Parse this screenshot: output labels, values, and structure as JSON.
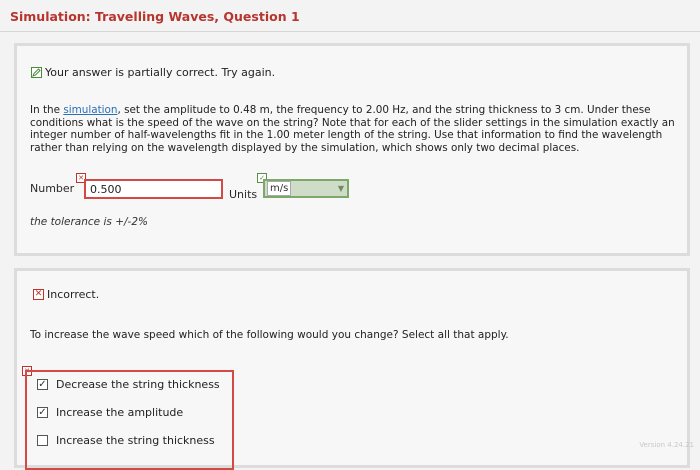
{
  "header": {
    "title": "Simulation: Travelling Waves, Question 1"
  },
  "part1": {
    "status": "Your answer is partially correct.  Try again.",
    "question_pre": "In the ",
    "question_link": "simulation",
    "question_post": ", set the amplitude to 0.48 m, the frequency to 2.00 Hz, and the string thickness to 3 cm. Under these conditions what is the speed of the wave on the string? Note that for each of the slider settings in the simulation exactly an integer number of half-wavelengths fit in the 1.00 meter length of the string. Use that information to find the wavelength rather than relying on the wavelength displayed by the simulation, which shows only two decimal places.",
    "number_label": "Number",
    "number_value": "0.500",
    "units_label": "Units",
    "units_value": "m/s",
    "tolerance": "the tolerance is +/-2%"
  },
  "part2": {
    "status": "Incorrect.",
    "question": "To increase the wave speed which of the following would you change? Select all that apply.",
    "choices": [
      {
        "label": "Decrease the string thickness",
        "checked": true
      },
      {
        "label": "Increase the amplitude",
        "checked": true
      },
      {
        "label": "Increase the string thickness",
        "checked": false
      }
    ]
  },
  "footer": {
    "text": "Version 4.24.21"
  },
  "colors": {
    "title": "#b8352e",
    "error_border": "#d34a45",
    "ok_border": "#7ca86c",
    "link": "#2b6fb6"
  }
}
